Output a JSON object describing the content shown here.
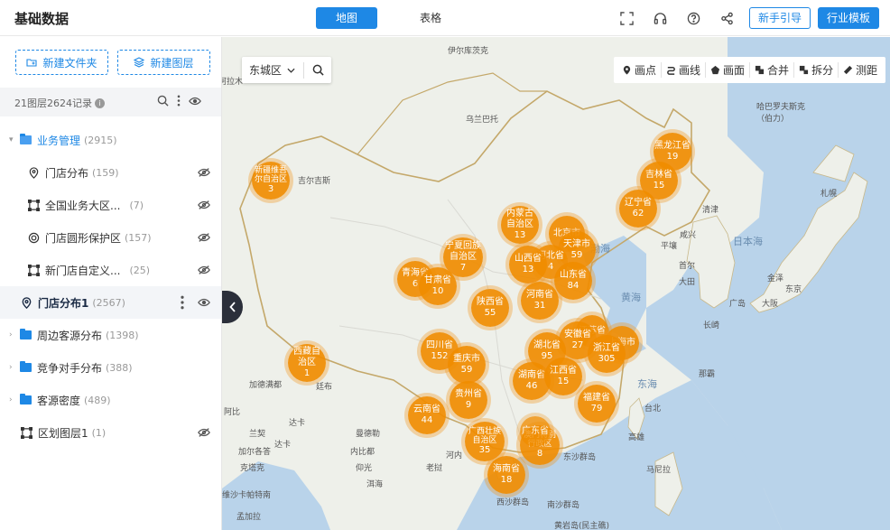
{
  "header": {
    "title": "基础数据",
    "tabs": [
      {
        "label": "地图"
      },
      {
        "label": "表格"
      }
    ],
    "guide_label": "新手引导",
    "template_label": "行业模板"
  },
  "sidebar": {
    "new_folder_label": "新建文件夹",
    "new_layer_label": "新建图层",
    "stats_text": "21图层2624记录",
    "items": [
      {
        "label": "业务管理",
        "count": "(2915)"
      },
      {
        "label": "门店分布",
        "count": "(159)"
      },
      {
        "label": "全国业务大区...",
        "count": "(7)"
      },
      {
        "label": "门店圆形保护区",
        "count": "(157)"
      },
      {
        "label": "新门店自定义...",
        "count": "(25)"
      },
      {
        "label": "门店分布1",
        "count": "(2567)"
      },
      {
        "label": "周边客源分布",
        "count": "(1398)"
      },
      {
        "label": "竞争对手分布",
        "count": "(388)"
      },
      {
        "label": "客源密度",
        "count": "(489)"
      },
      {
        "label": "区划图层1",
        "count": "(1)"
      }
    ]
  },
  "map": {
    "search_district": "东城区",
    "toolbar": [
      {
        "label": "画点",
        "icon": "pin-icon"
      },
      {
        "label": "画线",
        "icon": "line-icon"
      },
      {
        "label": "画面",
        "icon": "polygon-icon"
      },
      {
        "label": "合并",
        "icon": "merge-icon"
      },
      {
        "label": "拆分",
        "icon": "split-icon"
      },
      {
        "label": "测距",
        "icon": "ruler-icon"
      }
    ],
    "places": [
      "伊尔库茨克",
      "乌兰巴托",
      "哈巴罗夫斯克（伯力）",
      "阿拉木",
      "吉尔吉斯",
      "札幌",
      "清津",
      "咸兴",
      "平壤",
      "日本海",
      "首尔",
      "金泽",
      "大田",
      "东京",
      "广岛",
      "大阪",
      "长崎",
      "黄海",
      "东海",
      "加德满都",
      "廷布",
      "阿比",
      "达卡",
      "兰契",
      "内比都",
      "曼德勒",
      "达卡",
      "仰光",
      "加尔各答",
      "克塔克",
      "河内",
      "老挝",
      "东沙群岛",
      "西沙群岛",
      "南沙群岛",
      "黄岩岛(民主礁)",
      "马尼拉",
      "台北",
      "高雄",
      "那霸",
      "渤海",
      "维沙卡帕特南",
      "洱海",
      "孟加拉"
    ],
    "clusters": [
      {
        "name": "黑龙江省",
        "count": "19"
      },
      {
        "name": "吉林省",
        "count": "15"
      },
      {
        "name": "辽宁省",
        "count": "62"
      },
      {
        "name": "新疆维吾尔自治区",
        "count": "3"
      },
      {
        "name": "内蒙古自治区",
        "count": "13"
      },
      {
        "name": "北京市",
        "count": ""
      },
      {
        "name": "天津市",
        "count": "59"
      },
      {
        "name": "宁夏回族自治区",
        "count": "7"
      },
      {
        "name": "河北省",
        "count": "4"
      },
      {
        "name": "山西省",
        "count": "13"
      },
      {
        "name": "山东省",
        "count": "84"
      },
      {
        "name": "青海省",
        "count": "6"
      },
      {
        "name": "甘肃省",
        "count": "10"
      },
      {
        "name": "陕西省",
        "count": "55"
      },
      {
        "name": "河南省",
        "count": "31"
      },
      {
        "name": "江苏省",
        "count": ""
      },
      {
        "name": "安徽省",
        "count": "27"
      },
      {
        "name": "上海市",
        "count": ""
      },
      {
        "name": "四川省",
        "count": "152"
      },
      {
        "name": "湖北省",
        "count": "95"
      },
      {
        "name": "浙江省",
        "count": "305"
      },
      {
        "name": "西藏自治区",
        "count": "1"
      },
      {
        "name": "重庆市",
        "count": "59"
      },
      {
        "name": "湖南省",
        "count": "46"
      },
      {
        "name": "江西省",
        "count": "15"
      },
      {
        "name": "贵州省",
        "count": "9"
      },
      {
        "name": "福建省",
        "count": "79"
      },
      {
        "name": "云南省",
        "count": "44"
      },
      {
        "name": "广西壮族自治区",
        "count": "35"
      },
      {
        "name": "澳门特别行政区",
        "count": "8"
      },
      {
        "name": "广东省",
        "count": ""
      },
      {
        "name": "海南省",
        "count": "18"
      }
    ]
  }
}
